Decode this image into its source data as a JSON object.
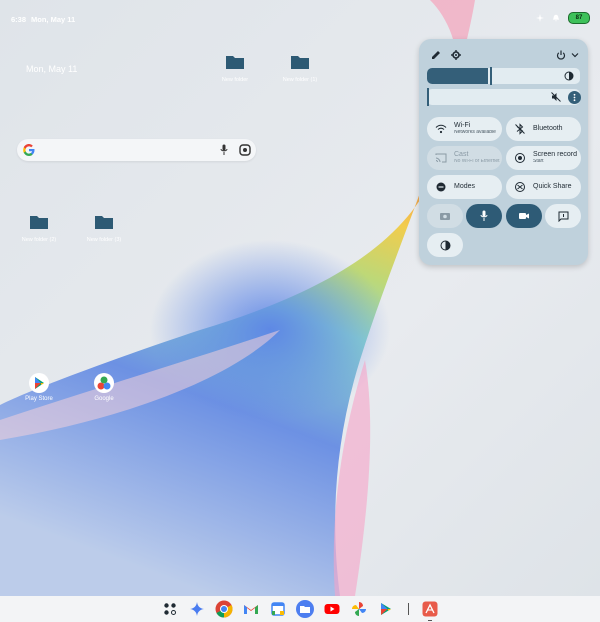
{
  "status_bar": {
    "time": "6:38",
    "date": "Mon, May 11",
    "battery": "87"
  },
  "home": {
    "date_widget": "Mon, May 11",
    "folders": [
      {
        "label": "New folder"
      },
      {
        "label": "New folder (1)"
      },
      {
        "label": "New folder (2)"
      },
      {
        "label": "New folder (3)"
      }
    ],
    "apps": [
      {
        "label": "Play Store",
        "icon": "play-store-icon"
      },
      {
        "label": "Google",
        "icon": "google-folder-icon"
      }
    ]
  },
  "quick_settings": {
    "brightness_level": 0.4,
    "volume_level": 0.0,
    "tiles": {
      "wifi": {
        "label": "Wi-Fi",
        "sub": "Networks available"
      },
      "bluetooth": {
        "label": "Bluetooth"
      },
      "cast": {
        "label": "Cast",
        "sub": "No Wi-Fi or Ethernet"
      },
      "screen_record": {
        "label": "Screen record",
        "sub": "Start"
      },
      "modes": {
        "label": "Modes"
      },
      "quick_share": {
        "label": "Quick Share"
      }
    }
  },
  "dock": {
    "apps": [
      "apps-grid-icon",
      "gemini-icon",
      "chrome-icon",
      "gmail-icon",
      "calendar-icon",
      "files-icon",
      "youtube-icon",
      "photos-icon",
      "play-store-icon",
      "recent-app-icon"
    ]
  },
  "colors": {
    "accent": "#345f79",
    "panel": "#bfd1dc",
    "tile": "#e6eef2",
    "active_tile": "#2e5b76"
  }
}
